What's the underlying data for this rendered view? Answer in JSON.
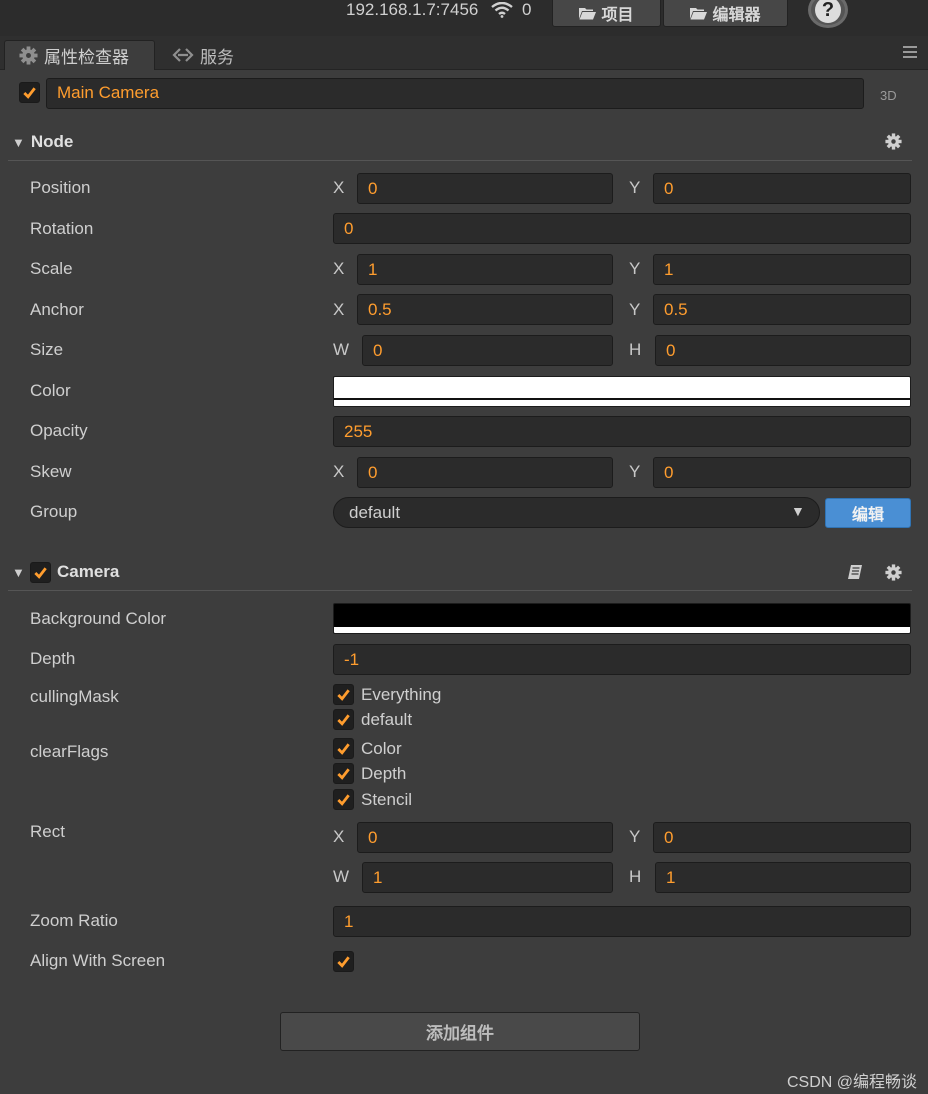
{
  "topbar": {
    "ip": "192.168.1.7:7456",
    "connections": "0",
    "project_label": "项目",
    "editor_label": "编辑器",
    "help_label": "?"
  },
  "tabs": {
    "inspector": "属性检查器",
    "service": "服务"
  },
  "node_header": {
    "enabled": true,
    "name": "Main Camera",
    "mode_label": "3D"
  },
  "node_section": {
    "title": "Node",
    "position": {
      "label": "Position",
      "x_axis": "X",
      "x": "0",
      "y_axis": "Y",
      "y": "0"
    },
    "rotation": {
      "label": "Rotation",
      "value": "0"
    },
    "scale": {
      "label": "Scale",
      "x_axis": "X",
      "x": "1",
      "y_axis": "Y",
      "y": "1"
    },
    "anchor": {
      "label": "Anchor",
      "x_axis": "X",
      "x": "0.5",
      "y_axis": "Y",
      "y": "0.5"
    },
    "size": {
      "label": "Size",
      "w_axis": "W",
      "w": "0",
      "h_axis": "H",
      "h": "0"
    },
    "color": {
      "label": "Color",
      "value": "#ffffff"
    },
    "opacity": {
      "label": "Opacity",
      "value": "255"
    },
    "skew": {
      "label": "Skew",
      "x_axis": "X",
      "x": "0",
      "y_axis": "Y",
      "y": "0"
    },
    "group": {
      "label": "Group",
      "value": "default",
      "edit_label": "编辑"
    }
  },
  "camera_section": {
    "title": "Camera",
    "enabled": true,
    "background_color": {
      "label": "Background Color",
      "value": "#000000"
    },
    "depth": {
      "label": "Depth",
      "value": "-1"
    },
    "culling_mask": {
      "label": "cullingMask",
      "options": [
        {
          "label": "Everything",
          "checked": true
        },
        {
          "label": "default",
          "checked": true
        }
      ]
    },
    "clear_flags": {
      "label": "clearFlags",
      "options": [
        {
          "label": "Color",
          "checked": true
        },
        {
          "label": "Depth",
          "checked": true
        },
        {
          "label": "Stencil",
          "checked": true
        }
      ]
    },
    "rect": {
      "label": "Rect",
      "x_axis": "X",
      "x": "0",
      "y_axis": "Y",
      "y": "0",
      "w_axis": "W",
      "w": "1",
      "h_axis": "H",
      "h": "1"
    },
    "zoom_ratio": {
      "label": "Zoom Ratio",
      "value": "1"
    },
    "align_with_screen": {
      "label": "Align With Screen",
      "checked": true
    }
  },
  "add_component_label": "添加组件",
  "watermark": "CSDN @编程畅谈",
  "colors": {
    "accent": "#ff9d2e",
    "button_blue": "#4a8fd4",
    "panel": "#3d3d3d"
  },
  "icons": {
    "wifi": "wifi-icon",
    "folder": "folder-open-icon",
    "gear": "gear-icon",
    "book": "book-icon",
    "link": "link-icon",
    "menu": "menu-icon",
    "check": "check-icon",
    "dropdown": "dropdown-arrow-icon"
  }
}
